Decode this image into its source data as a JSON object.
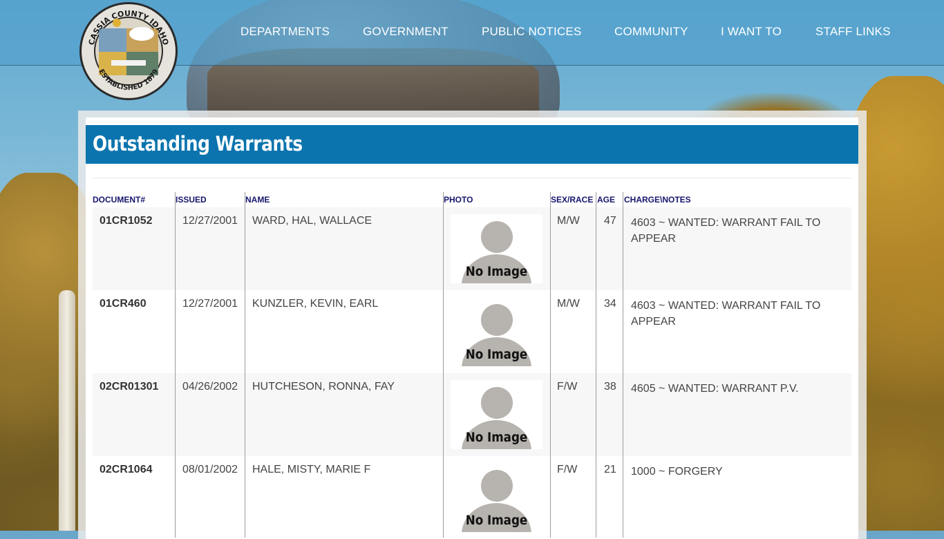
{
  "nav": {
    "items": [
      "DEPARTMENTS",
      "GOVERNMENT",
      "PUBLIC NOTICES",
      "COMMUNITY",
      "I WANT TO",
      "STAFF LINKS"
    ]
  },
  "seal": {
    "top_text": "CASSIA COUNTY IDAHO",
    "bottom_text": "ESTABLISHED 1879"
  },
  "page": {
    "title": "Outstanding Warrants"
  },
  "table": {
    "headers": [
      "DOCUMENT#",
      "ISSUED",
      "NAME",
      "PHOTO",
      "SEX/RACE",
      "AGE",
      "CHARGE\\NOTES"
    ],
    "no_image_label": "No Image",
    "rows": [
      {
        "doc": "01CR1052",
        "issued": "12/27/2001",
        "name": "WARD, HAL, WALLACE",
        "sexrace": "M/W",
        "age": "47",
        "charge": "4603 ~ WANTED: WARRANT FAIL TO APPEAR"
      },
      {
        "doc": "01CR460",
        "issued": "12/27/2001",
        "name": "KUNZLER, KEVIN, EARL",
        "sexrace": "M/W",
        "age": "34",
        "charge": "4603 ~ WANTED: WARRANT FAIL TO APPEAR"
      },
      {
        "doc": "02CR01301",
        "issued": "04/26/2002",
        "name": "HUTCHESON, RONNA, FAY",
        "sexrace": "F/W",
        "age": "38",
        "charge": "4605 ~ WANTED: WARRANT P.V."
      },
      {
        "doc": "02CR1064",
        "issued": "08/01/2002",
        "name": "HALE, MISTY, MARIE F",
        "sexrace": "F/W",
        "age": "21",
        "charge": "1000 ~ FORGERY"
      }
    ]
  },
  "colors": {
    "title_bar": "#0b74ae",
    "header_text": "#15156e",
    "row_alt": "#f7f7f7"
  }
}
